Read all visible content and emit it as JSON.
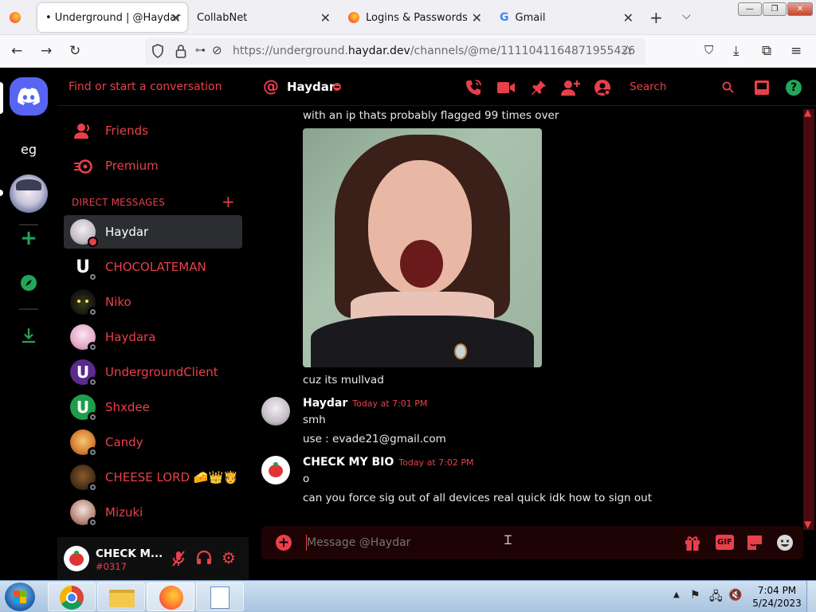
{
  "browser": {
    "tabs": [
      {
        "label": "• Underground | @Haydar",
        "active": true
      },
      {
        "label": "CollabNet",
        "active": false
      },
      {
        "label": "Logins & Passwords",
        "active": false
      },
      {
        "label": "Gmail",
        "active": false
      }
    ],
    "url_prefix": "https://underground.",
    "url_domain": "haydar.dev",
    "url_path": "/channels/@me/1111041164871955426"
  },
  "servers": {
    "text_server": "eg"
  },
  "dm_panel": {
    "search_placeholder": "Find or start a conversation",
    "friends_label": "Friends",
    "premium_label": "Premium",
    "section_header": "DIRECT MESSAGES",
    "add_symbol": "+",
    "dms": [
      {
        "name": "Haydar",
        "status": "dnd",
        "active": true
      },
      {
        "name": "CHOCOLATEMAN",
        "status": "offline"
      },
      {
        "name": "Niko",
        "status": "offline"
      },
      {
        "name": "Haydara",
        "status": "offline"
      },
      {
        "name": "UndergroundClient",
        "status": "offline"
      },
      {
        "name": "Shxdee",
        "status": "offline"
      },
      {
        "name": "Candy",
        "status": "offline"
      },
      {
        "name": "CHEESE LORD 🧀👑🫅",
        "status": "offline"
      },
      {
        "name": "Mizuki",
        "status": "offline"
      }
    ]
  },
  "user_panel": {
    "name": "CHECK M...",
    "tag": "#0317"
  },
  "chat_header": {
    "name": "Haydar",
    "search_placeholder": "Search"
  },
  "messages": {
    "top_line": "with an ip thats probably flagged 99 times over",
    "image_caption": "cuz its mullvad",
    "group1": {
      "author": "Haydar",
      "time": "Today at 7:01 PM",
      "lines": [
        "smh",
        "use : evade21@gmail.com"
      ]
    },
    "group2": {
      "author": "CHECK MY BIO",
      "time": "Today at 7:02 PM",
      "lines": [
        "o",
        "can you force sig out of all devices real quick idk how to sign out"
      ]
    }
  },
  "composer": {
    "placeholder": "Message @Haydar",
    "gif_label": "GIF"
  },
  "taskbar": {
    "time": "7:04 PM",
    "date": "5/24/2023"
  },
  "colors": {
    "accent": "#e8404a",
    "blurple": "#5865f2",
    "green": "#23a55a"
  }
}
